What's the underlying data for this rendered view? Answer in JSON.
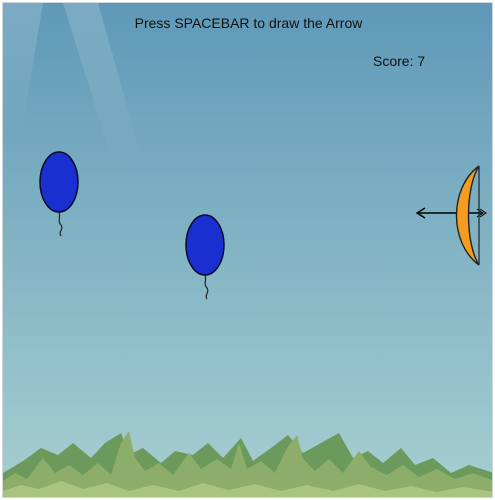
{
  "hud": {
    "instruction": "Press SPACEBAR to draw the Arrow",
    "score_label": "Score:",
    "score_value": 7
  },
  "colors": {
    "sky_top": "#5f99b8",
    "sky_bottom": "#a7cfd1",
    "balloon_fill": "#1a2fd0",
    "balloon_outline": "#0a0a2a",
    "bow_fill": "#f39c1f",
    "arrow": "#000000",
    "grass_back": "#6b9a5c",
    "grass_mid": "#8dae6a",
    "grass_front": "#a9c47f"
  },
  "sprites": {
    "balloons": [
      {
        "color": "blue"
      },
      {
        "color": "blue"
      }
    ],
    "bow": {
      "icon": "bow-icon"
    },
    "arrow": {
      "icon": "arrow-icon",
      "direction": "left"
    }
  }
}
